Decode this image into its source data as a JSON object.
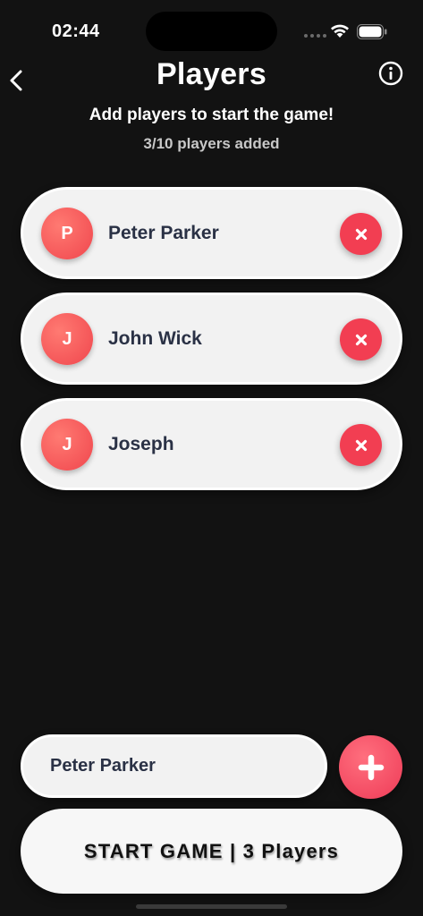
{
  "status_bar": {
    "time": "02:44"
  },
  "header": {
    "title": "Players",
    "subtitle": "Add players to start the game!",
    "count_text": "3/10 players added"
  },
  "players": [
    {
      "initial": "P",
      "name": "Peter Parker"
    },
    {
      "initial": "J",
      "name": "John Wick"
    },
    {
      "initial": "J",
      "name": "Joseph"
    }
  ],
  "input": {
    "value": "Peter Parker"
  },
  "start_button": {
    "label": "START GAME | 3 Players"
  },
  "icons": {
    "back": "chevron-left-icon",
    "info": "info-circle-icon",
    "remove": "close-icon",
    "add": "plus-icon"
  },
  "colors": {
    "background": "#121212",
    "accent": "#f23e52",
    "card": "#f2f2f2",
    "text_dark": "#2a3145"
  }
}
